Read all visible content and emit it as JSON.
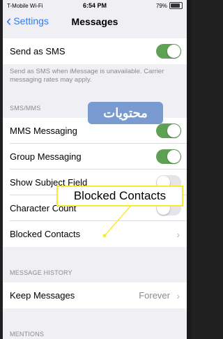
{
  "status_bar": {
    "carrier": "T-Mobile Wi-Fi",
    "time": "6:54 PM",
    "battery": "79%",
    "battery_level": 0.79
  },
  "nav": {
    "back_label": "Settings",
    "title": "Messages"
  },
  "send_as_sms": {
    "label": "Send as SMS",
    "enabled": true
  },
  "sms_footnote": "Send as SMS when iMessage is unavailable. Carrier messaging rates may apply.",
  "sms_mms_header": "SMS/MMS",
  "mms_messaging": {
    "label": "MMS Messaging",
    "enabled": true
  },
  "group_messaging": {
    "label": "Group Messaging",
    "enabled": true
  },
  "show_subject": {
    "label": "Show Subject Field",
    "enabled": false
  },
  "character_count": {
    "label": "Character Count",
    "enabled": false
  },
  "blocked_contacts": {
    "label": "Blocked Contacts"
  },
  "history_header": "MESSAGE HISTORY",
  "keep_messages": {
    "label": "Keep Messages",
    "value": "Forever"
  },
  "mentions_header": "MENTIONS",
  "watermark_text": "محتويات",
  "callout_text": "Blocked Contacts",
  "colors": {
    "accent": "#2f7bf5",
    "toggle_on": "#5fa154",
    "callout_border": "#f7ec30"
  }
}
